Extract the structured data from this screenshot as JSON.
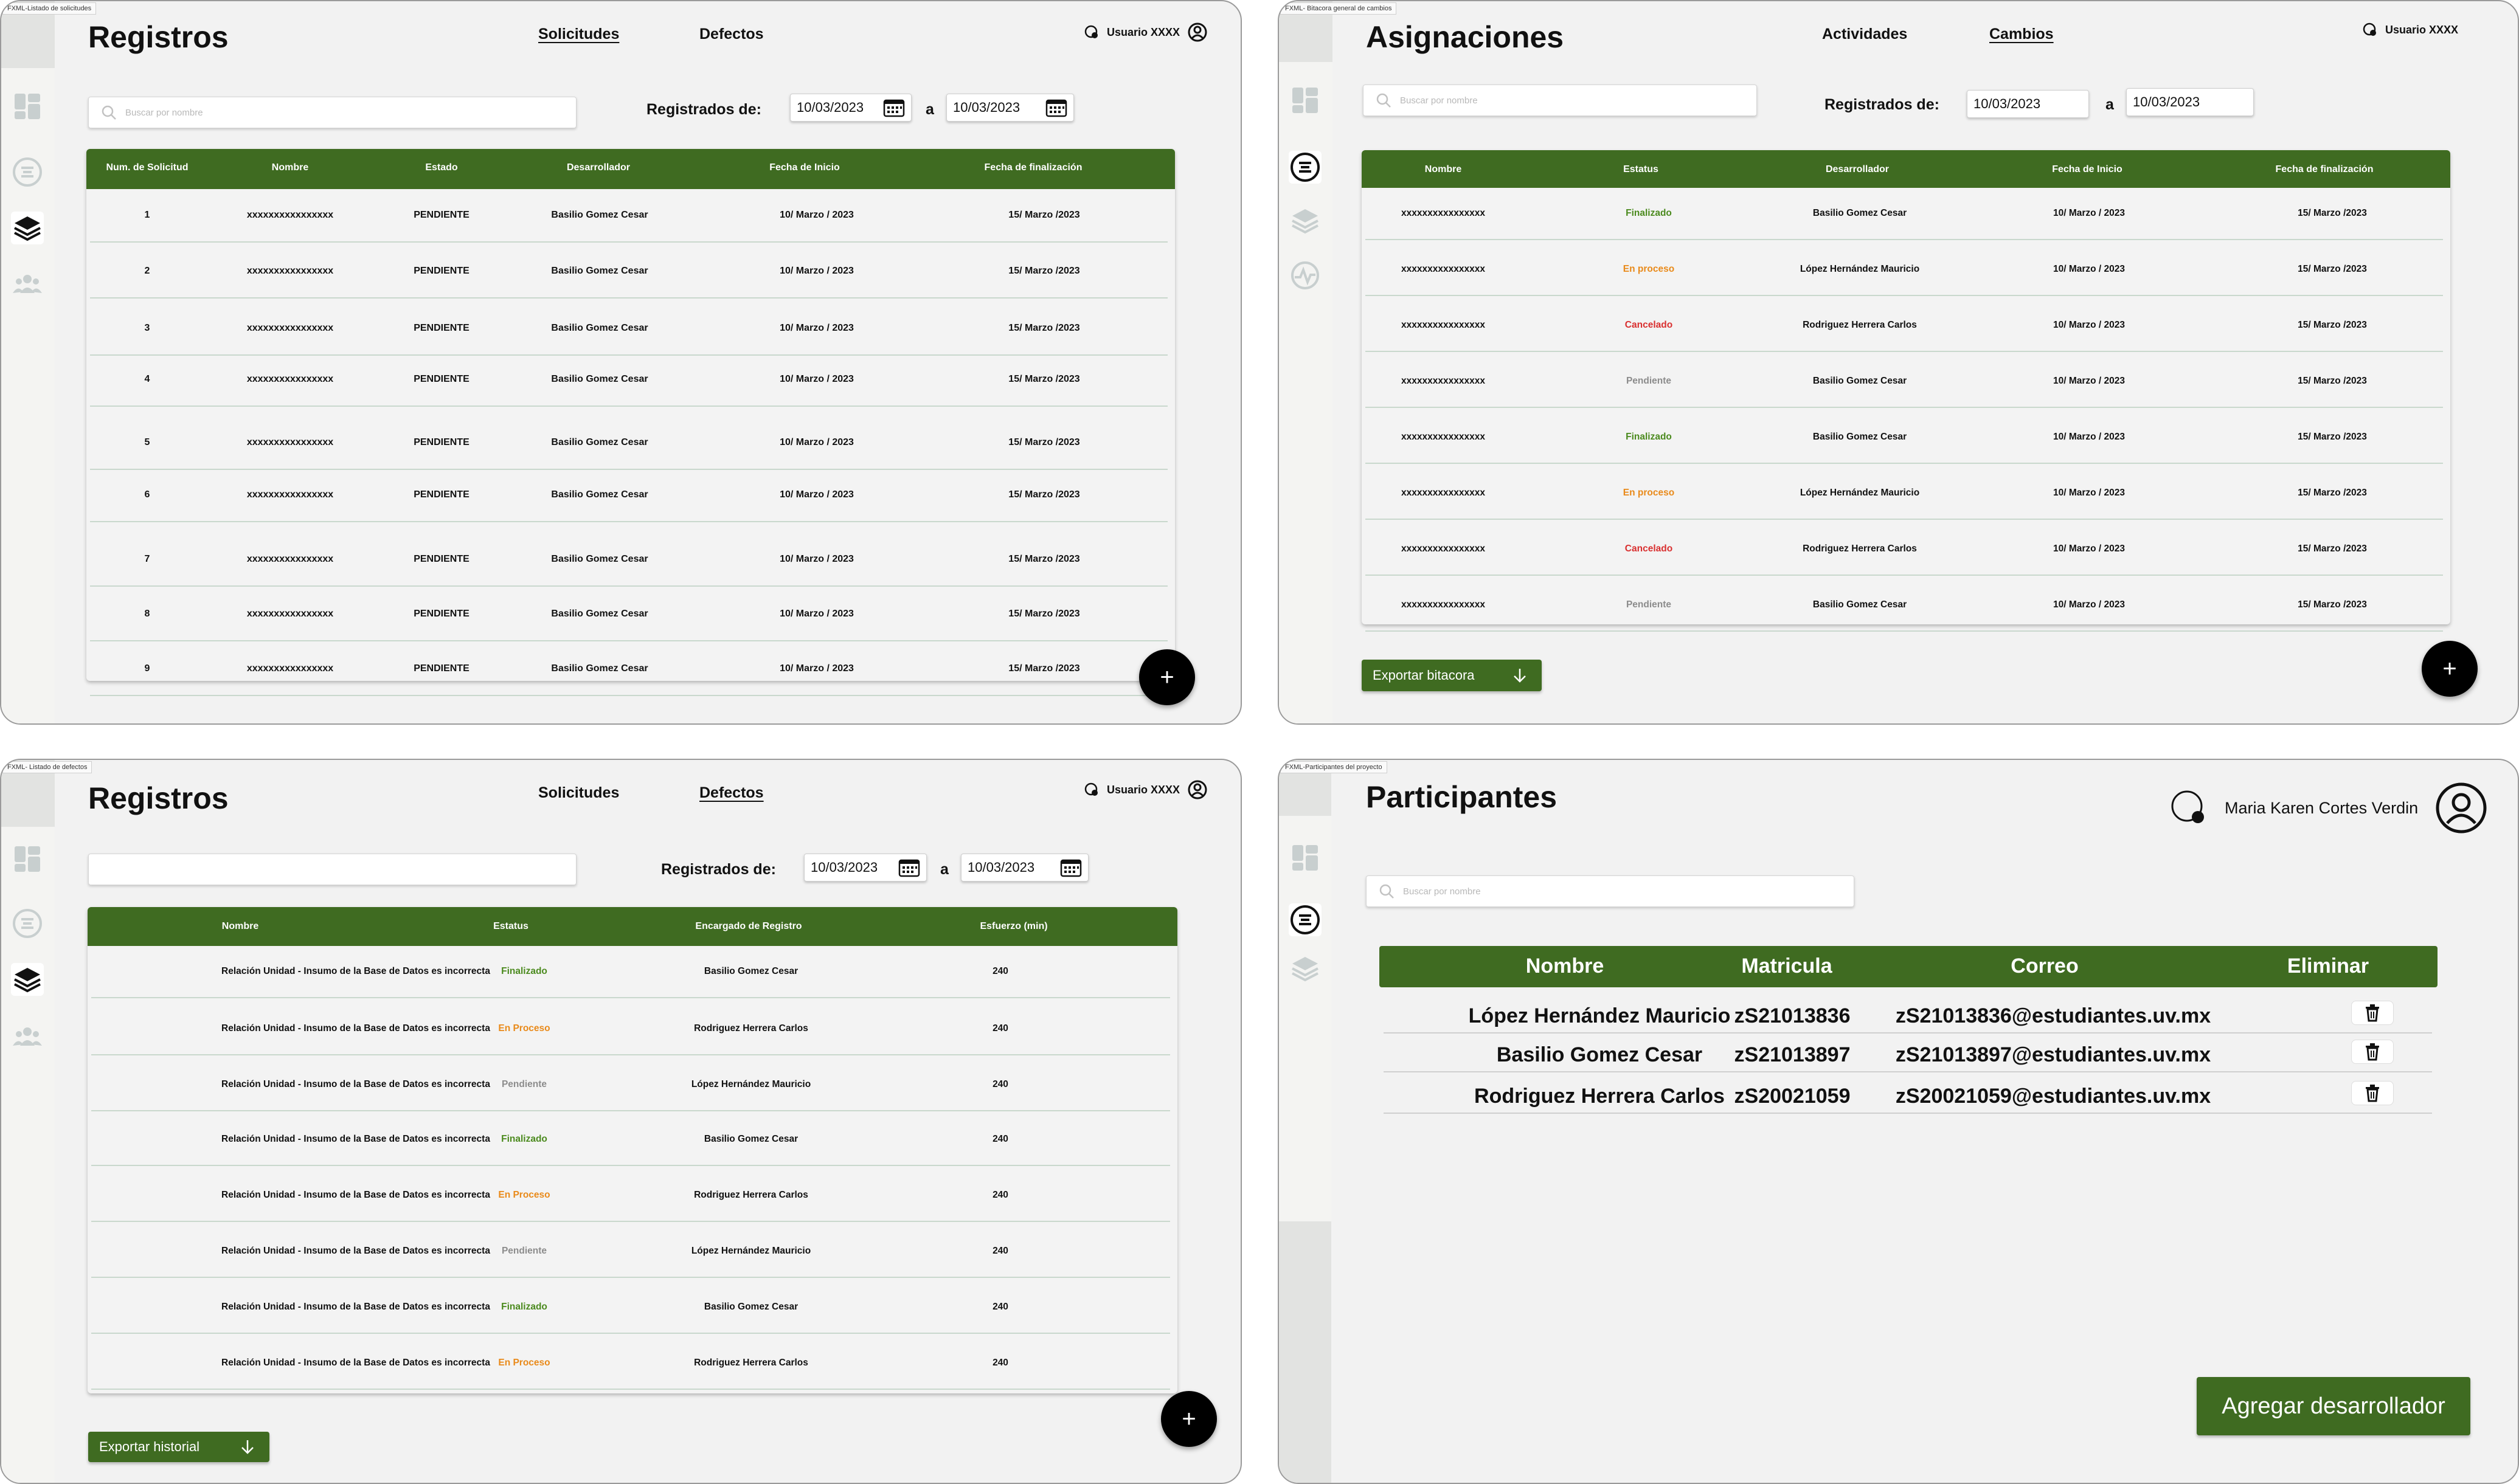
{
  "colors": {
    "accent": "#3f6b21",
    "finalizado": "#4b8a1e",
    "en_proceso": "#e98a1a",
    "cancelado": "#d93030",
    "pendiente": "#8c8c8c"
  },
  "screen1": {
    "tag": "FXML-Listado de solicitudes",
    "title": "Registros",
    "nav": [
      "Solicitudes",
      "Defectos"
    ],
    "user": "Usuario XXXX",
    "search_placeholder": "Buscar por nombre",
    "registered_label": "Registrados de:",
    "date_from": "10/03/2023",
    "date_sep": "a",
    "date_to": "10/03/2023",
    "columns": [
      "Num. de Solicitud",
      "Nombre",
      "Estado",
      "Desarrollador",
      "Fecha de Inicio",
      "Fecha de finalización"
    ],
    "rows": [
      [
        "1",
        "xxxxxxxxxxxxxxxx",
        "PENDIENTE",
        "Basilio Gomez Cesar",
        "10/ Marzo / 2023",
        "15/ Marzo /2023"
      ],
      [
        "2",
        "xxxxxxxxxxxxxxxx",
        "PENDIENTE",
        "Basilio Gomez Cesar",
        "10/ Marzo / 2023",
        "15/ Marzo /2023"
      ],
      [
        "3",
        "xxxxxxxxxxxxxxxx",
        "PENDIENTE",
        "Basilio Gomez Cesar",
        "10/ Marzo / 2023",
        "15/ Marzo /2023"
      ],
      [
        "4",
        "xxxxxxxxxxxxxxxx",
        "PENDIENTE",
        "Basilio Gomez Cesar",
        "10/ Marzo / 2023",
        "15/ Marzo /2023"
      ],
      [
        "5",
        "xxxxxxxxxxxxxxxx",
        "PENDIENTE",
        "Basilio Gomez Cesar",
        "10/ Marzo / 2023",
        "15/ Marzo /2023"
      ],
      [
        "6",
        "xxxxxxxxxxxxxxxx",
        "PENDIENTE",
        "Basilio Gomez Cesar",
        "10/ Marzo / 2023",
        "15/ Marzo /2023"
      ],
      [
        "7",
        "xxxxxxxxxxxxxxxx",
        "PENDIENTE",
        "Basilio Gomez Cesar",
        "10/ Marzo / 2023",
        "15/ Marzo /2023"
      ],
      [
        "8",
        "xxxxxxxxxxxxxxxx",
        "PENDIENTE",
        "Basilio Gomez Cesar",
        "10/ Marzo / 2023",
        "15/ Marzo /2023"
      ],
      [
        "9",
        "xxxxxxxxxxxxxxxx",
        "PENDIENTE",
        "Basilio Gomez Cesar",
        "10/ Marzo / 2023",
        "15/ Marzo /2023"
      ]
    ],
    "fab": "+"
  },
  "screen2": {
    "tag": "FXML- Bitacora general de cambios",
    "title": "Asignaciones",
    "nav": [
      "Actividades",
      "Cambios"
    ],
    "user": "Usuario XXXX",
    "search_placeholder": "Buscar por nombre",
    "registered_label": "Registrados de:",
    "date_from": "10/03/2023",
    "date_sep": "a",
    "date_to": "10/03/2023",
    "columns": [
      "Nombre",
      "Estatus",
      "Desarrollador",
      "Fecha de Inicio",
      "Fecha de finalización"
    ],
    "rows": [
      [
        "xxxxxxxxxxxxxxxx",
        "Finalizado",
        "Basilio Gomez Cesar",
        "10/ Marzo / 2023",
        "15/ Marzo /2023"
      ],
      [
        "xxxxxxxxxxxxxxxx",
        "En proceso",
        "López Hernández Mauricio",
        "10/ Marzo / 2023",
        "15/ Marzo /2023"
      ],
      [
        "xxxxxxxxxxxxxxxx",
        "Cancelado",
        "Rodriguez Herrera Carlos",
        "10/ Marzo / 2023",
        "15/ Marzo /2023"
      ],
      [
        "xxxxxxxxxxxxxxxx",
        "Pendiente",
        "Basilio Gomez Cesar",
        "10/ Marzo / 2023",
        "15/ Marzo /2023"
      ],
      [
        "xxxxxxxxxxxxxxxx",
        "Finalizado",
        "Basilio Gomez Cesar",
        "10/ Marzo / 2023",
        "15/ Marzo /2023"
      ],
      [
        "xxxxxxxxxxxxxxxx",
        "En proceso",
        "López Hernández Mauricio",
        "10/ Marzo / 2023",
        "15/ Marzo /2023"
      ],
      [
        "xxxxxxxxxxxxxxxx",
        "Cancelado",
        "Rodriguez Herrera Carlos",
        "10/ Marzo / 2023",
        "15/ Marzo /2023"
      ],
      [
        "xxxxxxxxxxxxxxxx",
        "Pendiente",
        "Basilio Gomez Cesar",
        "10/ Marzo / 2023",
        "15/ Marzo /2023"
      ]
    ],
    "export_label": "Exportar bitacora",
    "fab": "+"
  },
  "screen3": {
    "tag": "FXML- Listado de defectos",
    "title": "Registros",
    "nav": [
      "Solicitudes",
      "Defectos"
    ],
    "user": "Usuario XXXX",
    "search_placeholder": "",
    "registered_label": "Registrados de:",
    "date_from": "10/03/2023",
    "date_sep": "a",
    "date_to": "10/03/2023",
    "columns": [
      "Nombre",
      "Estatus",
      "Encargado de Registro",
      "Esfuerzo (min)"
    ],
    "rows": [
      [
        "Relación Unidad - Insumo de la Base de Datos es incorrecta",
        "Finalizado",
        "Basilio Gomez Cesar",
        "240"
      ],
      [
        "Relación Unidad - Insumo de la Base de Datos es incorrecta",
        "En Proceso",
        "Rodriguez Herrera Carlos",
        "240"
      ],
      [
        "Relación Unidad - Insumo de la Base de Datos es incorrecta",
        "Pendiente",
        "López Hernández Mauricio",
        "240"
      ],
      [
        "Relación Unidad - Insumo de la Base de Datos es incorrecta",
        "Finalizado",
        "Basilio Gomez Cesar",
        "240"
      ],
      [
        "Relación Unidad - Insumo de la Base de Datos es incorrecta",
        "En Proceso",
        "Rodriguez Herrera Carlos",
        "240"
      ],
      [
        "Relación Unidad - Insumo de la Base de Datos es incorrecta",
        "Pendiente",
        "López Hernández Mauricio",
        "240"
      ],
      [
        "Relación Unidad - Insumo de la Base de Datos es incorrecta",
        "Finalizado",
        "Basilio Gomez Cesar",
        "240"
      ],
      [
        "Relación Unidad - Insumo de la Base de Datos es incorrecta",
        "En Proceso",
        "Rodriguez Herrera Carlos",
        "240"
      ]
    ],
    "export_label": "Exportar historial",
    "fab": "+"
  },
  "screen4": {
    "tag": "FXML-Participantes del proyecto",
    "title": "Participantes",
    "user": "Maria Karen Cortes Verdin",
    "search_placeholder": "Buscar por nombre",
    "columns": [
      "Nombre",
      "Matricula",
      "Correo",
      "Eliminar"
    ],
    "rows": [
      [
        "López Hernández Mauricio",
        "zS21013836",
        "zS21013836@estudiantes.uv.mx"
      ],
      [
        "Basilio Gomez Cesar",
        "zS21013897",
        "zS21013897@estudiantes.uv.mx"
      ],
      [
        "Rodriguez Herrera Carlos",
        "zS20021059",
        "zS20021059@estudiantes.uv.mx"
      ]
    ],
    "add_label": "Agregar desarrollador"
  }
}
